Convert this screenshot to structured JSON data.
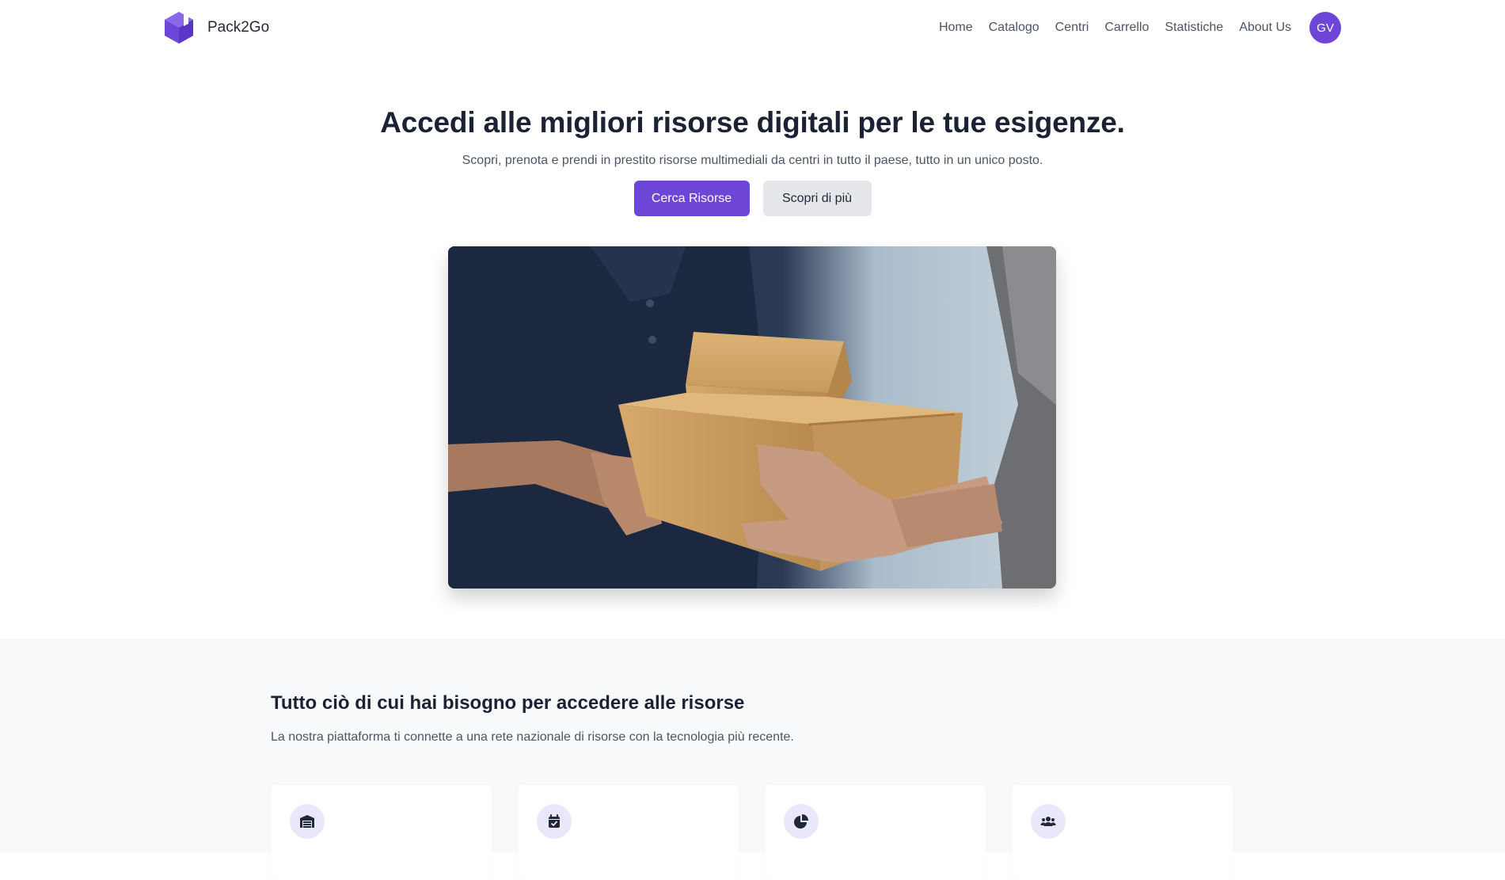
{
  "brand": {
    "name": "Pack2Go",
    "logo_icon": "hexagon-box-icon",
    "accent_color": "#6d46d8"
  },
  "nav": {
    "links": [
      "Home",
      "Catalogo",
      "Centri",
      "Carrello",
      "Statistiche",
      "About Us"
    ],
    "avatar_initials": "GV"
  },
  "hero": {
    "title": "Accedi alle migliori risorse digitali per le tue esigenze.",
    "subtitle": "Scopri, prenota e prendi in prestito risorse multimediali da centri in tutto il paese, tutto in un unico posto.",
    "primary_button": "Cerca Risorse",
    "secondary_button": "Scopri di più",
    "image_alt": "delivery-boxes-handover-photo"
  },
  "features": {
    "title": "Tutto ciò di cui hai bisogno per accedere alle risorse",
    "subtitle": "La nostra piattaforma ti connette a una rete nazionale di risorse con la tecnologia più recente.",
    "cards": [
      {
        "icon": "warehouse-icon"
      },
      {
        "icon": "calendar-check-icon"
      },
      {
        "icon": "pie-chart-icon"
      },
      {
        "icon": "users-icon"
      }
    ]
  }
}
